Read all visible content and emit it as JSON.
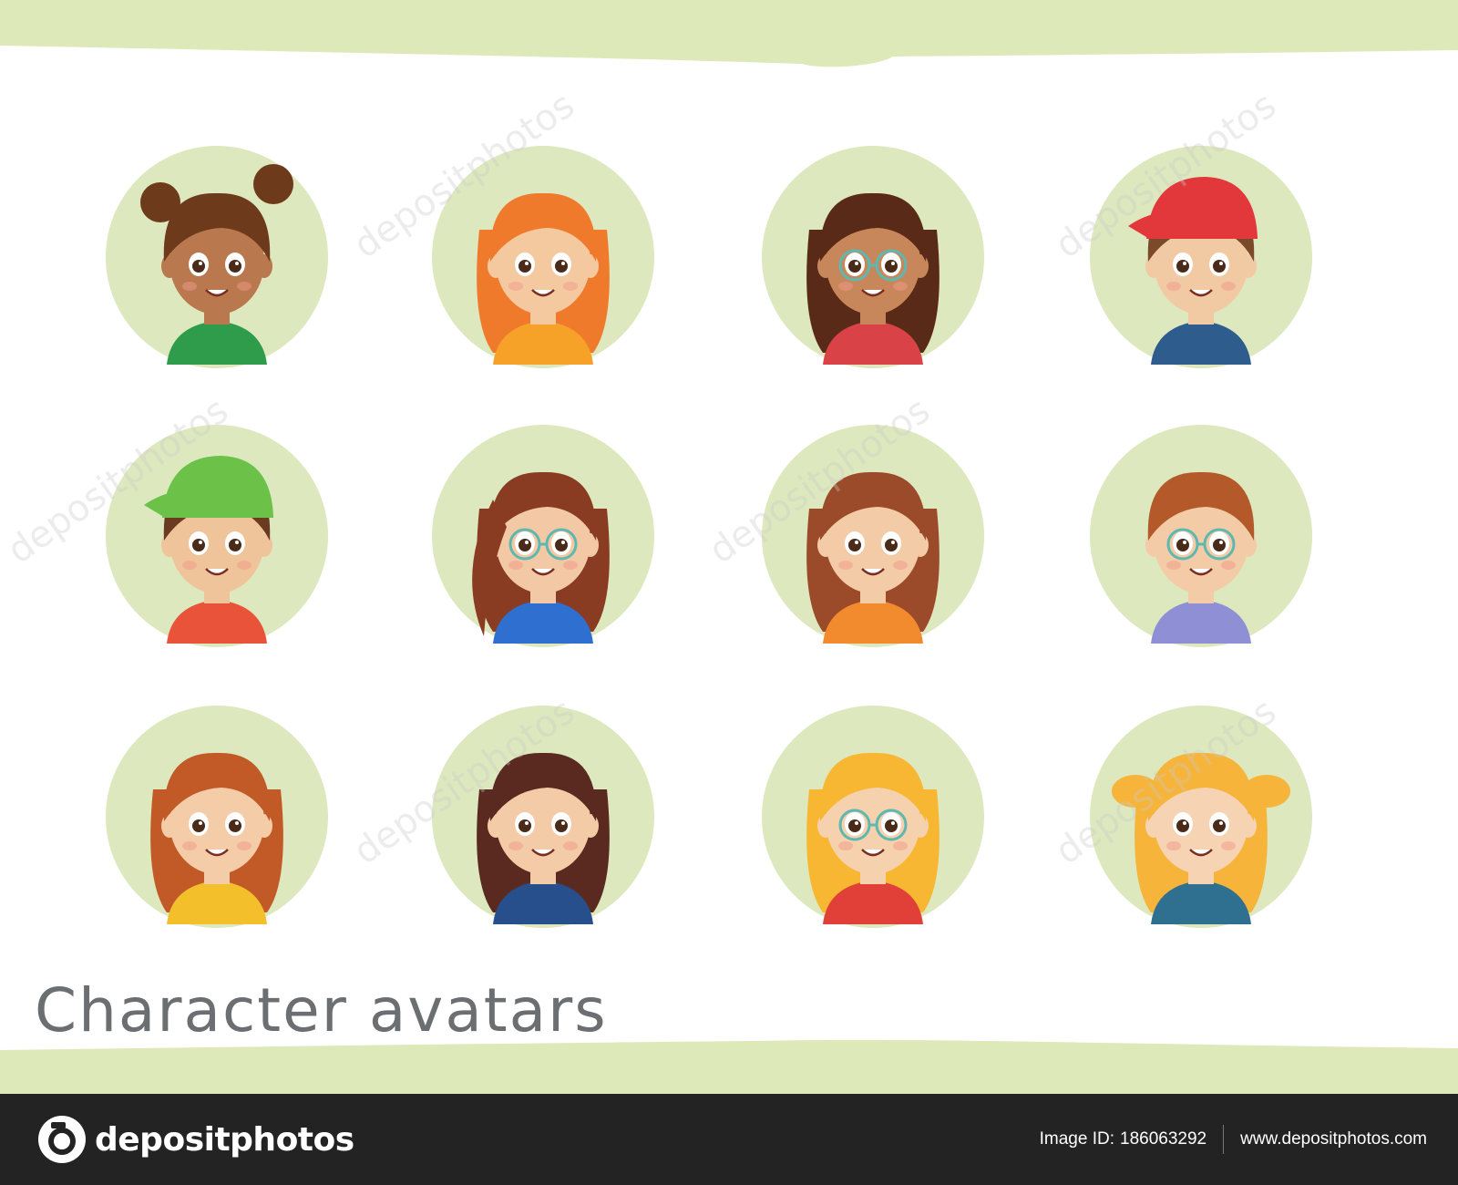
{
  "title": "Character avatars",
  "footer": {
    "brand": "depositphotos",
    "image_id_label": "Image ID:",
    "image_id": "186063292",
    "site": "www.depositphotos.com"
  },
  "watermark": "depositphotos",
  "colors": {
    "band": "#dde9b8",
    "circle": "#dde8be",
    "title": "#6b6f72",
    "footer": "#232323"
  },
  "avatars": [
    {
      "name": "girl-dark-buns",
      "hair": "#6e3a1c",
      "skin": "#b9784e",
      "shirt": "#2e9c4a",
      "style": "buns",
      "glasses": false,
      "cap": ""
    },
    {
      "name": "girl-red-wavy",
      "hair": "#f07a2b",
      "skin": "#f4c9a0",
      "shirt": "#f6a229",
      "style": "long",
      "glasses": false,
      "cap": ""
    },
    {
      "name": "girl-brown-glasses",
      "hair": "#5a2a18",
      "skin": "#c8865b",
      "shirt": "#d94348",
      "style": "long",
      "glasses": true,
      "cap": ""
    },
    {
      "name": "boy-red-cap",
      "hair": "#7a4a2a",
      "skin": "#f1c9a2",
      "shirt": "#2e5c8c",
      "style": "short",
      "glasses": false,
      "cap": "#e2373b"
    },
    {
      "name": "boy-green-cap",
      "hair": "#6a3b20",
      "skin": "#f0c49b",
      "shirt": "#e8533a",
      "style": "short",
      "glasses": false,
      "cap": "#6cc249"
    },
    {
      "name": "girl-ponytail-glasses",
      "hair": "#8a3c22",
      "skin": "#f2c9a4",
      "shirt": "#2f6fd0",
      "style": "ponytail",
      "glasses": true,
      "cap": ""
    },
    {
      "name": "girl-brown-bob",
      "hair": "#9b4a2a",
      "skin": "#f3cba6",
      "shirt": "#f28a2e",
      "style": "long",
      "glasses": false,
      "cap": ""
    },
    {
      "name": "boy-round-glasses",
      "hair": "#b45a2a",
      "skin": "#f3cba6",
      "shirt": "#8f8fd6",
      "style": "short",
      "glasses": true,
      "cap": ""
    },
    {
      "name": "girl-auburn-long",
      "hair": "#c25a28",
      "skin": "#f4cca8",
      "shirt": "#f3c02c",
      "style": "long",
      "glasses": false,
      "cap": ""
    },
    {
      "name": "girl-dark-bob",
      "hair": "#5a2a20",
      "skin": "#f3cba6",
      "shirt": "#264f8c",
      "style": "bob",
      "glasses": false,
      "cap": ""
    },
    {
      "name": "girl-blonde-glasses",
      "hair": "#f7b733",
      "skin": "#f5d1ae",
      "shirt": "#e04038",
      "style": "long",
      "glasses": true,
      "cap": ""
    },
    {
      "name": "girl-blonde-pigtails",
      "hair": "#f6b43a",
      "skin": "#f6d3b2",
      "shirt": "#2f6f8f",
      "style": "pigtails",
      "glasses": false,
      "cap": ""
    }
  ]
}
